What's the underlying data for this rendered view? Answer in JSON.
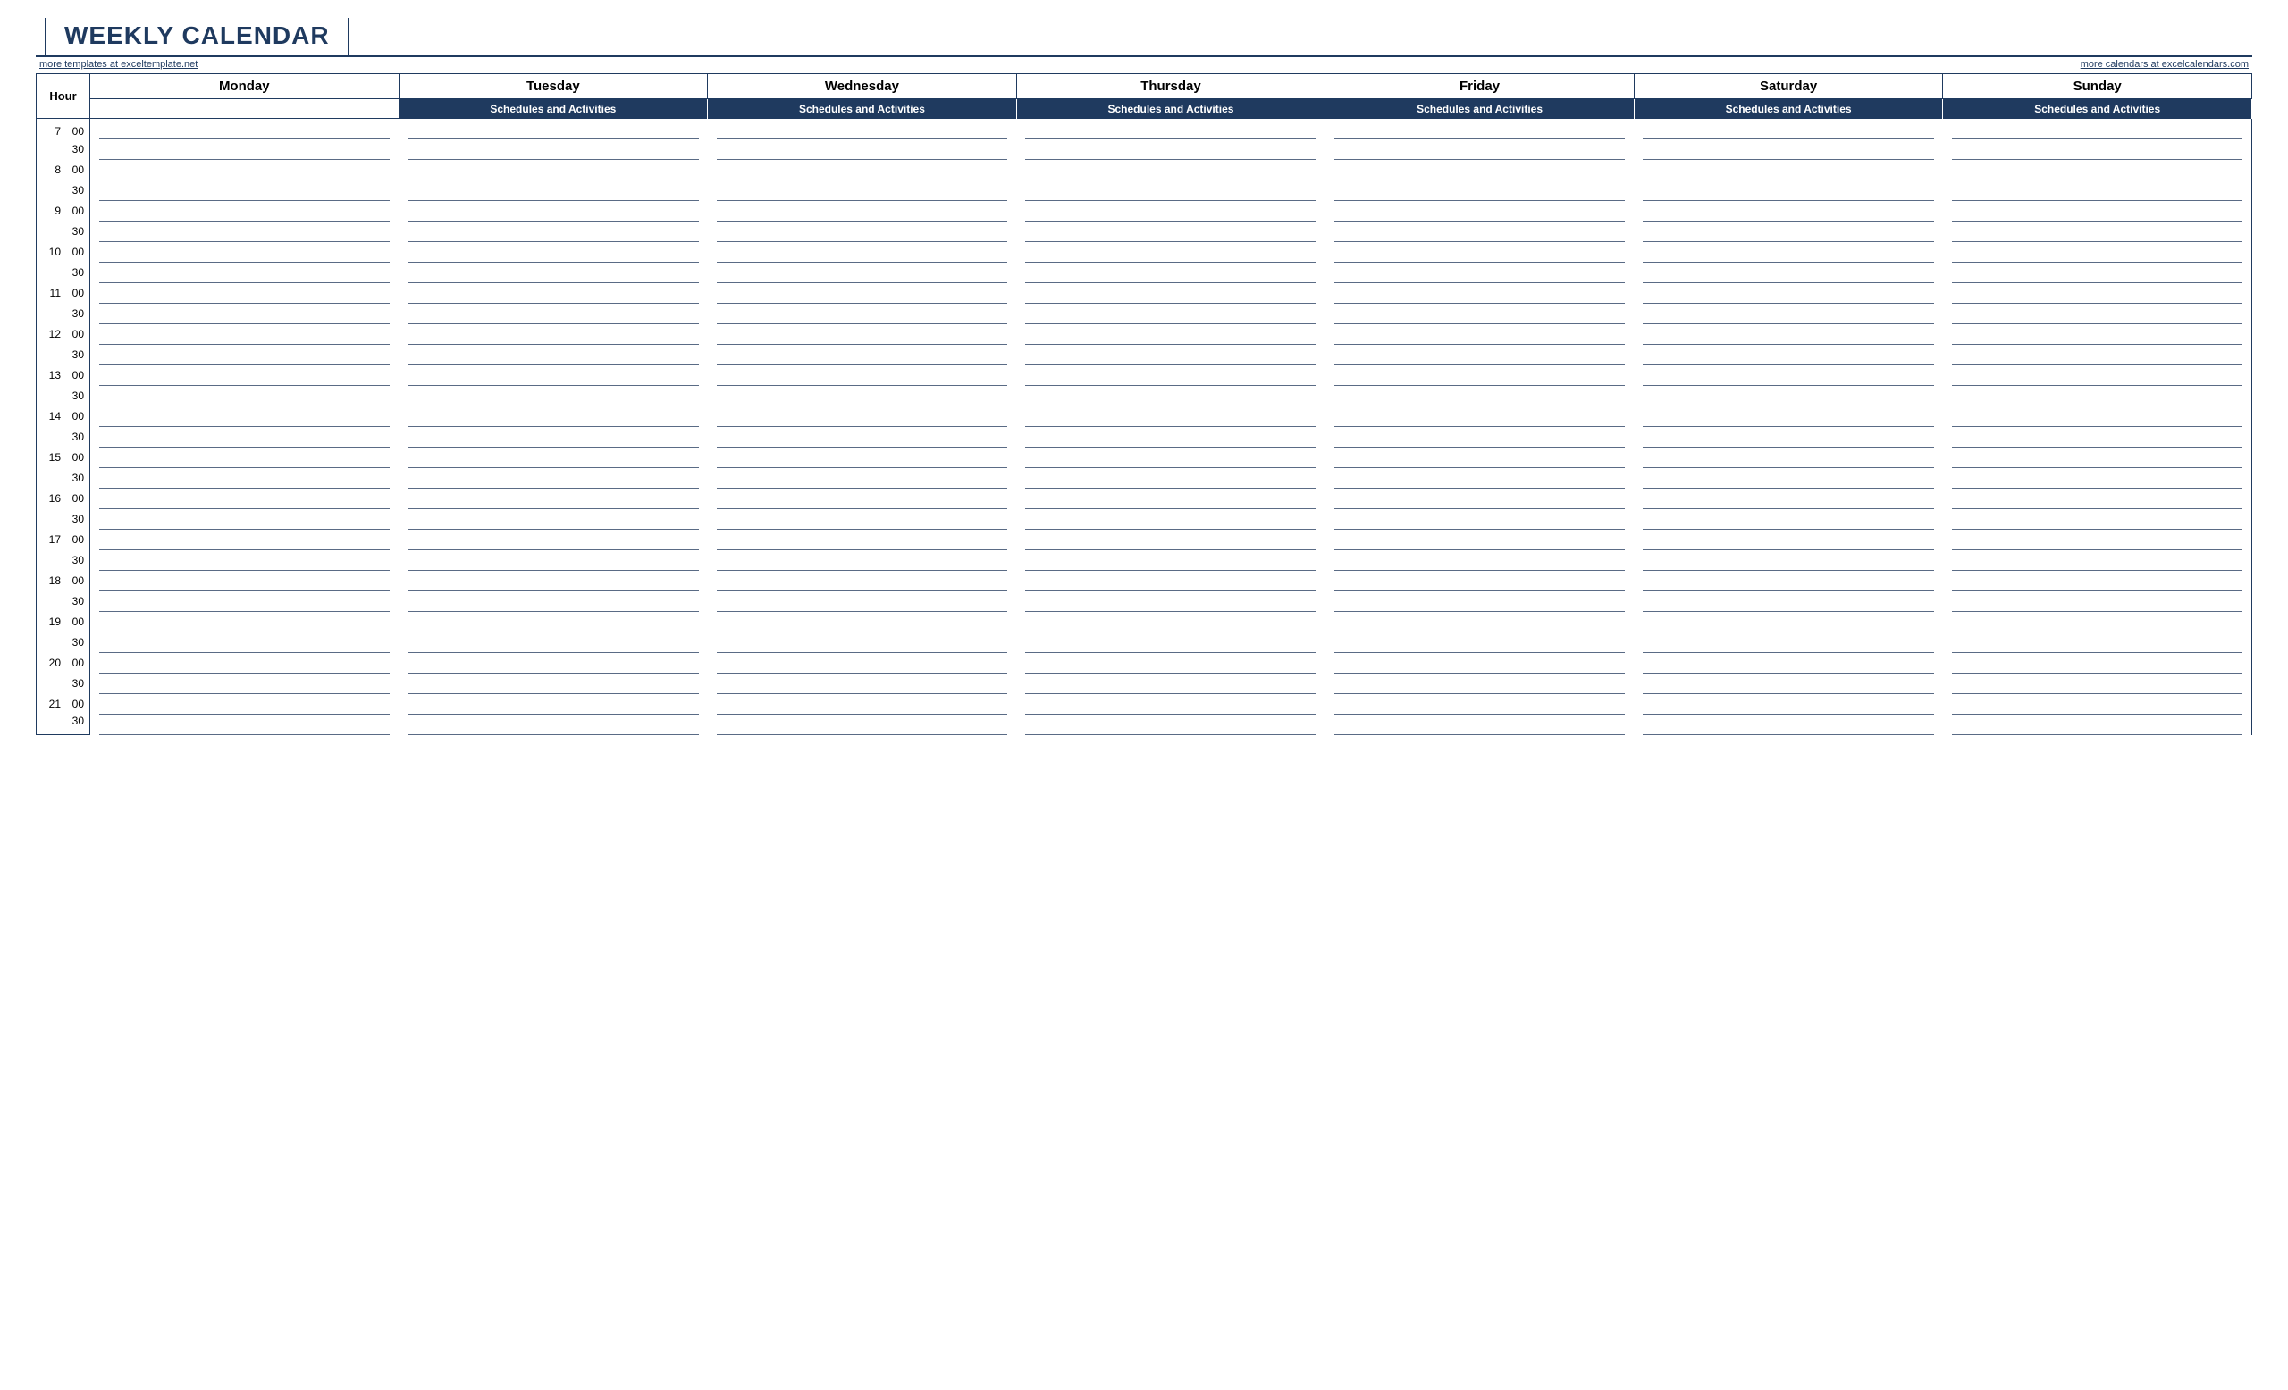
{
  "title": "WEEKLY CALENDAR",
  "links": {
    "left": "more templates at exceltemplate.net",
    "right": "more calendars at excelcalendars.com"
  },
  "hour_header": "Hour",
  "sub_header": "Schedules and Activities",
  "days": [
    "Monday",
    "Tuesday",
    "Wednesday",
    "Thursday",
    "Friday",
    "Saturday",
    "Sunday"
  ],
  "time_rows": [
    {
      "hour": "7",
      "min": "00"
    },
    {
      "hour": "",
      "min": "30"
    },
    {
      "hour": "8",
      "min": "00"
    },
    {
      "hour": "",
      "min": "30"
    },
    {
      "hour": "9",
      "min": "00"
    },
    {
      "hour": "",
      "min": "30"
    },
    {
      "hour": "10",
      "min": "00"
    },
    {
      "hour": "",
      "min": "30"
    },
    {
      "hour": "11",
      "min": "00"
    },
    {
      "hour": "",
      "min": "30"
    },
    {
      "hour": "12",
      "min": "00"
    },
    {
      "hour": "",
      "min": "30"
    },
    {
      "hour": "13",
      "min": "00"
    },
    {
      "hour": "",
      "min": "30"
    },
    {
      "hour": "14",
      "min": "00"
    },
    {
      "hour": "",
      "min": "30"
    },
    {
      "hour": "15",
      "min": "00"
    },
    {
      "hour": "",
      "min": "30"
    },
    {
      "hour": "16",
      "min": "00"
    },
    {
      "hour": "",
      "min": "30"
    },
    {
      "hour": "17",
      "min": "00"
    },
    {
      "hour": "",
      "min": "30"
    },
    {
      "hour": "18",
      "min": "00"
    },
    {
      "hour": "",
      "min": "30"
    },
    {
      "hour": "19",
      "min": "00"
    },
    {
      "hour": "",
      "min": "30"
    },
    {
      "hour": "20",
      "min": "00"
    },
    {
      "hour": "",
      "min": "30"
    },
    {
      "hour": "21",
      "min": "00"
    },
    {
      "hour": "",
      "min": "30"
    }
  ]
}
